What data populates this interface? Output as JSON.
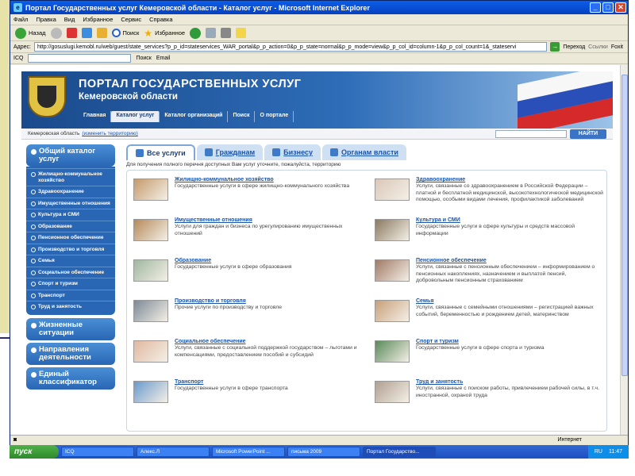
{
  "window": {
    "title": "Портал Государственных услуг Кемеровской области - Каталог услуг - Microsoft Internet Explorer",
    "buttons": [
      "_",
      "□",
      "✕"
    ]
  },
  "menu": [
    "Файл",
    "Правка",
    "Вид",
    "Избранное",
    "Сервис",
    "Справка"
  ],
  "toolbar": {
    "back": "Назад",
    "search": "Поиск",
    "favorites": "Избранное"
  },
  "address": {
    "label": "Адрес:",
    "url": "http://gosuslugi.kemobl.ru/web/guest/state_services?p_p_id=stateservices_WAR_portal&p_p_action=0&p_p_state=normal&p_p_mode=view&p_p_col_id=column-1&p_p_col_count=1&_stateservi",
    "go": "Переход",
    "links": "Ссылки",
    "foxit": "Foxit"
  },
  "icqbar": {
    "icq": "ICQ",
    "search": "Поиск",
    "email": "Email"
  },
  "portal": {
    "title": "ПОРТАЛ ГОСУДАРСТВЕННЫХ УСЛУГ",
    "subtitle": "Кемеровской области",
    "nav": [
      "Главная",
      "Каталог услуг",
      "Каталог организаций",
      "Поиск",
      "О портале"
    ],
    "region": "Кемеровская область",
    "region_change": "(изменить территорию)",
    "search_button": "НАЙТИ"
  },
  "sidebar": {
    "catalog_title": "Общий каталог услуг",
    "items": [
      "Жилищно-коммунальное хозяйство",
      "Здравоохранение",
      "Имущественные отношения",
      "Культура и СМИ",
      "Образование",
      "Пенсионное обеспечение",
      "Производство и торговля",
      "Семья",
      "Социальное обеспечение",
      "Спорт и туризм",
      "Транспорт",
      "Труд и занятость"
    ],
    "blocks": [
      "Жизненные ситуации",
      "Направления деятельности",
      "Единый классификатор"
    ]
  },
  "tabs": [
    "Все услуги",
    "Гражданам",
    "Бизнесу",
    "Органам власти"
  ],
  "intro": "Для получения полного перечня доступных Вам услуг уточните, пожалуйста, территорию",
  "services": [
    {
      "title": "Жилищно-коммунальное хозяйство",
      "desc": "Государственные услуги в сфере жилищно-коммунального хозяйства",
      "color": "#c49a6a"
    },
    {
      "title": "Здравоохранение",
      "desc": "Услуги, связанные со здравоохранением в Российской Федерации – платной и бесплатной медицинской, высокотехнологической медицинской помощью, особыми видами лечения, профилактикой заболеваний",
      "color": "#d9c8b8"
    },
    {
      "title": "Имущественные отношения",
      "desc": "Услуги для граждан и бизнеса по урегулированию имущественных отношений",
      "color": "#b58a5a"
    },
    {
      "title": "Культура и СМИ",
      "desc": "Государственные услуги в сфере культуры и средств массовой информации",
      "color": "#8a7a60"
    },
    {
      "title": "Образование",
      "desc": "Государственные услуги в сфере образования",
      "color": "#9fb7a0"
    },
    {
      "title": "Пенсионное обеспечение",
      "desc": "Услуги, связанные с пенсионным обеспечением – информированием о пенсионных накоплениях, назначением и выплатой пенсий, добровольным пенсионным страхованием",
      "color": "#a07a66"
    },
    {
      "title": "Производство и торговля",
      "desc": "Прочие услуги по производству и торговле",
      "color": "#7d8a96"
    },
    {
      "title": "Семья",
      "desc": "Услуги, связанные с семейными отношениями – регистрацией важных событий, беременностью и рождением детей, материнством",
      "color": "#c8a07a"
    },
    {
      "title": "Социальное обеспечение",
      "desc": "Услуги, связанные с социальной поддержкой государством – льготами и компенсациями, предоставлением пособий и субсидий",
      "color": "#e0b8a0"
    },
    {
      "title": "Спорт и туризм",
      "desc": "Государственные услуги в сфере спорта и туризма",
      "color": "#5a8a5a"
    },
    {
      "title": "Транспорт",
      "desc": "Государственные услуги в сфере транспорта",
      "color": "#6a9acc"
    },
    {
      "title": "Труд и занятость",
      "desc": "Услуги, связанные с поиском работы, привлечением рабочей силы, в т.ч. иностранной, охраной труда",
      "color": "#b0a090"
    }
  ],
  "status": {
    "zone": "Интернет"
  },
  "taskbar": {
    "start": "пуск",
    "tasks": [
      "ICQ",
      "Алекс.Л",
      "Microsoft PowerPoint ...",
      "письма 2009",
      "Портал Государство..."
    ],
    "lang": "RU",
    "time": "11:47"
  }
}
